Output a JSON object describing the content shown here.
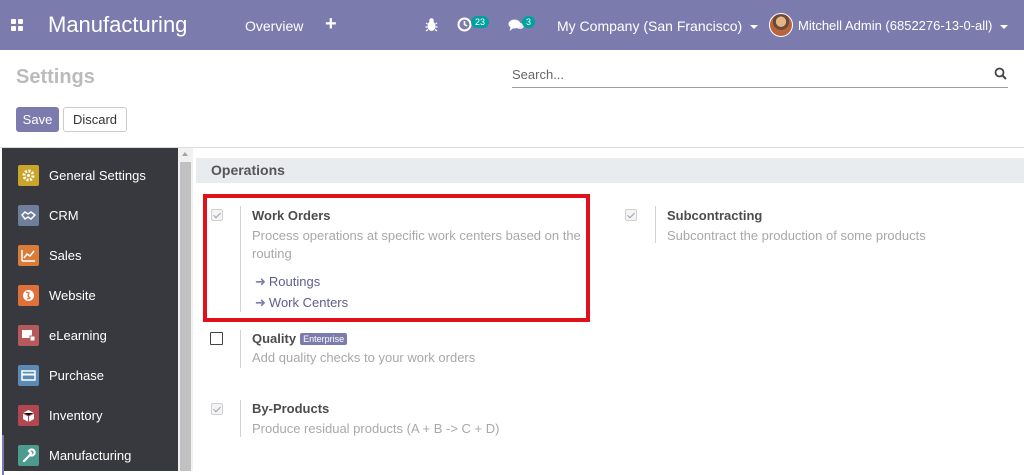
{
  "navbar": {
    "brand": "Manufacturing",
    "overview": "Overview",
    "add_symbol": "+",
    "activity_count": "23",
    "message_count": "3",
    "company": "My Company (San Francisco)",
    "user": "Mitchell Admin (6852276-13-0-all)",
    "colors": {
      "bar": "#7c7bad",
      "badge": "#00a09d"
    }
  },
  "control_panel": {
    "title": "Settings",
    "search_placeholder": "Search...",
    "save_label": "Save",
    "discard_label": "Discard"
  },
  "sidebar": {
    "items": [
      {
        "label": "General Settings",
        "icon": "gear-icon",
        "color": "#c9a52b"
      },
      {
        "label": "CRM",
        "icon": "handshake-icon",
        "color": "#6f7e9a"
      },
      {
        "label": "Sales",
        "icon": "sales-chart-icon",
        "color": "#d97c3a"
      },
      {
        "label": "Website",
        "icon": "globe-icon",
        "color": "#e0703a"
      },
      {
        "label": "eLearning",
        "icon": "elearning-icon",
        "color": "#b55a5a"
      },
      {
        "label": "Purchase",
        "icon": "purchase-card-icon",
        "color": "#5b8bb5"
      },
      {
        "label": "Inventory",
        "icon": "inventory-box-icon",
        "color": "#b3474f"
      },
      {
        "label": "Manufacturing",
        "icon": "wrench-icon",
        "color": "#4d9a8e",
        "active": true
      }
    ]
  },
  "section": {
    "title": "Operations",
    "settings": {
      "work_orders": {
        "title": "Work Orders",
        "desc_line1": "Process operations at specific work centers based on the",
        "desc_line2": "routing",
        "checked": true,
        "links": [
          "Routings",
          "Work Centers"
        ]
      },
      "subcontracting": {
        "title": "Subcontracting",
        "desc": "Subcontract the production of some products",
        "checked": true
      },
      "quality": {
        "title": "Quality",
        "badge": "Enterprise",
        "desc": "Add quality checks to your work orders",
        "checked": false
      },
      "by_products": {
        "title": "By-Products",
        "desc": "Produce residual products (A + B -> C + D)",
        "checked": true
      }
    }
  },
  "highlight_color": "#e0101c"
}
